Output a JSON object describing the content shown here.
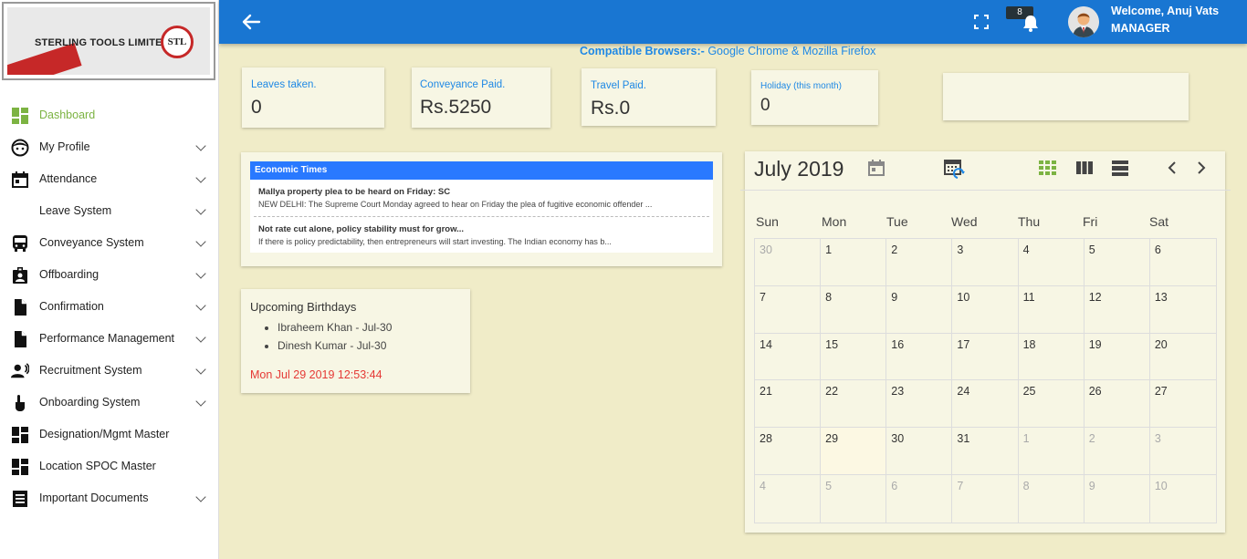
{
  "logo": {
    "company": "STERLING TOOLS LIMITED",
    "seal": "STL"
  },
  "sidebar": {
    "items": [
      {
        "label": "Dashboard",
        "icon": "dashboard-icon",
        "active": true,
        "chevron": false
      },
      {
        "label": "My Profile",
        "icon": "face-icon",
        "chevron": true
      },
      {
        "label": "Attendance",
        "icon": "calendar-icon",
        "chevron": true
      },
      {
        "label": "Leave System",
        "icon": "",
        "chevron": true
      },
      {
        "label": "Conveyance System",
        "icon": "bus-icon",
        "chevron": true
      },
      {
        "label": "Offboarding",
        "icon": "badge-icon",
        "chevron": true
      },
      {
        "label": "Confirmation",
        "icon": "file-icon",
        "chevron": true
      },
      {
        "label": "Performance Management",
        "icon": "file-icon",
        "chevron": true
      },
      {
        "label": "Recruitment System",
        "icon": "recruit-icon",
        "chevron": true
      },
      {
        "label": "Onboarding System",
        "icon": "hand-pointer-icon",
        "chevron": true
      },
      {
        "label": "Designation/Mgmt Master",
        "icon": "dashboard-icon",
        "chevron": false
      },
      {
        "label": "Location SPOC Master",
        "icon": "dashboard-icon",
        "chevron": false
      },
      {
        "label": "Important Documents",
        "icon": "document-list-icon",
        "chevron": true
      }
    ]
  },
  "topbar": {
    "notification_count": "8",
    "welcome": "Welcome, Anuj Vats",
    "role": "MANAGER"
  },
  "compat": {
    "label": "Compatible Browsers:-",
    "browsers": " Google Chrome & Mozilla Firefox"
  },
  "stats": {
    "leaves": {
      "label": "Leaves taken.",
      "value": "0"
    },
    "conveyance": {
      "label": "Conveyance Paid.",
      "value": "Rs.5250"
    },
    "travel": {
      "label": "Travel Paid.",
      "value": "Rs.0"
    },
    "holiday": {
      "label": "Holiday (this month)",
      "value": "0"
    }
  },
  "news": {
    "source": "Economic Times",
    "items": [
      {
        "title": "Mallya property plea to be heard on Friday: SC",
        "desc": "NEW DELHI: The Supreme Court Monday agreed to hear on Friday the plea of fugitive economic offender ..."
      },
      {
        "title": "Not rate cut alone, policy stability must for grow...",
        "desc": "If there is policy predictability, then entrepreneurs will start investing. The Indian economy has b..."
      }
    ]
  },
  "birthdays": {
    "title": "Upcoming Birthdays",
    "list": [
      "Ibraheem Khan - Jul-30",
      "Dinesh Kumar - Jul-30"
    ],
    "clock": "Mon Jul 29 2019 12:53:44"
  },
  "calendar": {
    "title": "July 2019",
    "days_of_week": [
      "Sun",
      "Mon",
      "Tue",
      "Wed",
      "Thu",
      "Fri",
      "Sat"
    ],
    "cells": [
      "30",
      "1",
      "2",
      "3",
      "4",
      "5",
      "6",
      "7",
      "8",
      "9",
      "10",
      "11",
      "12",
      "13",
      "14",
      "15",
      "16",
      "17",
      "18",
      "19",
      "20",
      "21",
      "22",
      "23",
      "24",
      "25",
      "26",
      "27",
      "28",
      "29",
      "30",
      "31",
      "1",
      "2",
      "3",
      "4",
      "5",
      "6",
      "7",
      "8",
      "9",
      "10"
    ],
    "muted_indices": [
      0,
      32,
      33,
      34,
      35,
      36,
      37,
      38,
      39,
      40,
      41
    ],
    "today_index": 29
  }
}
